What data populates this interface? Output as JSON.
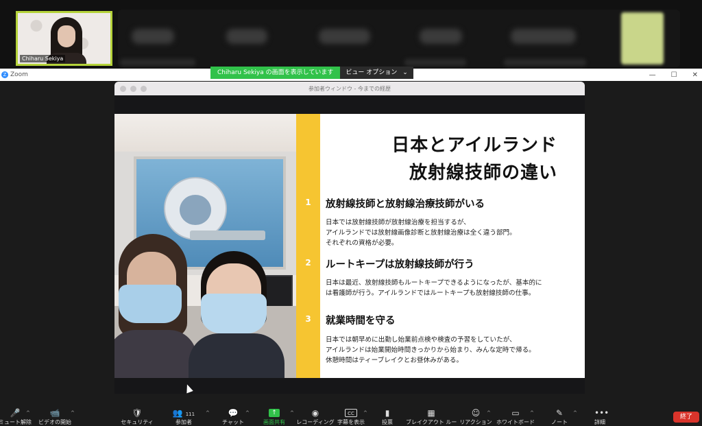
{
  "self_view": {
    "name": "Chiharu Sekiya"
  },
  "share_banner": {
    "status": "Chiharu  Sekiya の画面を表示しています",
    "view_options": "ビュー オプション",
    "caret": "⌄"
  },
  "zoom_window": {
    "title": "Zoom",
    "minimize": "—",
    "maximize": "☐",
    "close": "✕"
  },
  "shared_window": {
    "title": "参加者ウィンドウ - 今までの経歴"
  },
  "slide": {
    "title_line1": "日本とアイルランド",
    "title_line2": "放射線技師の違い",
    "items": [
      {
        "number": "1",
        "heading": "放射線技師と放射線治療技師がいる",
        "body": [
          "日本では放射線技師が放射線治療を担当するが、",
          "アイルランドでは放射線画像診断と放射線治療は全く違う部門。",
          "それぞれの資格が必要。"
        ]
      },
      {
        "number": "2",
        "heading": "ルートキープは放射線技師が行う",
        "body": [
          "日本は最近、放射線技師もルートキープできるようになったが、基本的に",
          "は看護師が行う。アイルランドではルートキープも放射線技師の仕事。"
        ]
      },
      {
        "number": "3",
        "heading": "就業時間を守る",
        "body": [
          "日本では朝早めに出勤し始業前点検や検査の予習をしていたが、",
          "アイルランドは始業開始時間きっかりから始まり、みんな定時で帰る。",
          "休憩時間はティーブレイクとお昼休みがある。"
        ]
      }
    ]
  },
  "toolbar": {
    "mute": {
      "label": "ミュート解除",
      "icon": "🎤"
    },
    "video": {
      "label": "ビデオの開始",
      "icon": "📹"
    },
    "security": {
      "label": "セキュリティ",
      "icon": "🛡"
    },
    "participants": {
      "label": "参加者",
      "icon": "👥",
      "count": "111"
    },
    "chat": {
      "label": "チャット",
      "icon": "💬"
    },
    "share": {
      "label": "画面共有",
      "icon": "↑"
    },
    "record": {
      "label": "レコーディング",
      "icon": "◉"
    },
    "captions": {
      "label": "字幕を表示",
      "icon": "CC"
    },
    "polls": {
      "label": "投票",
      "icon": "▮"
    },
    "breakout": {
      "label": "ブレイクアウト ルーム",
      "icon": "▦"
    },
    "reactions": {
      "label": "リアクション",
      "icon": "☺"
    },
    "whiteboard": {
      "label": "ホワイトボード",
      "icon": "▭"
    },
    "notes": {
      "label": "ノート",
      "icon": "✎"
    },
    "more": {
      "label": "詳細",
      "icon": "•••"
    },
    "end": {
      "label": "終了"
    },
    "caret": "^"
  }
}
